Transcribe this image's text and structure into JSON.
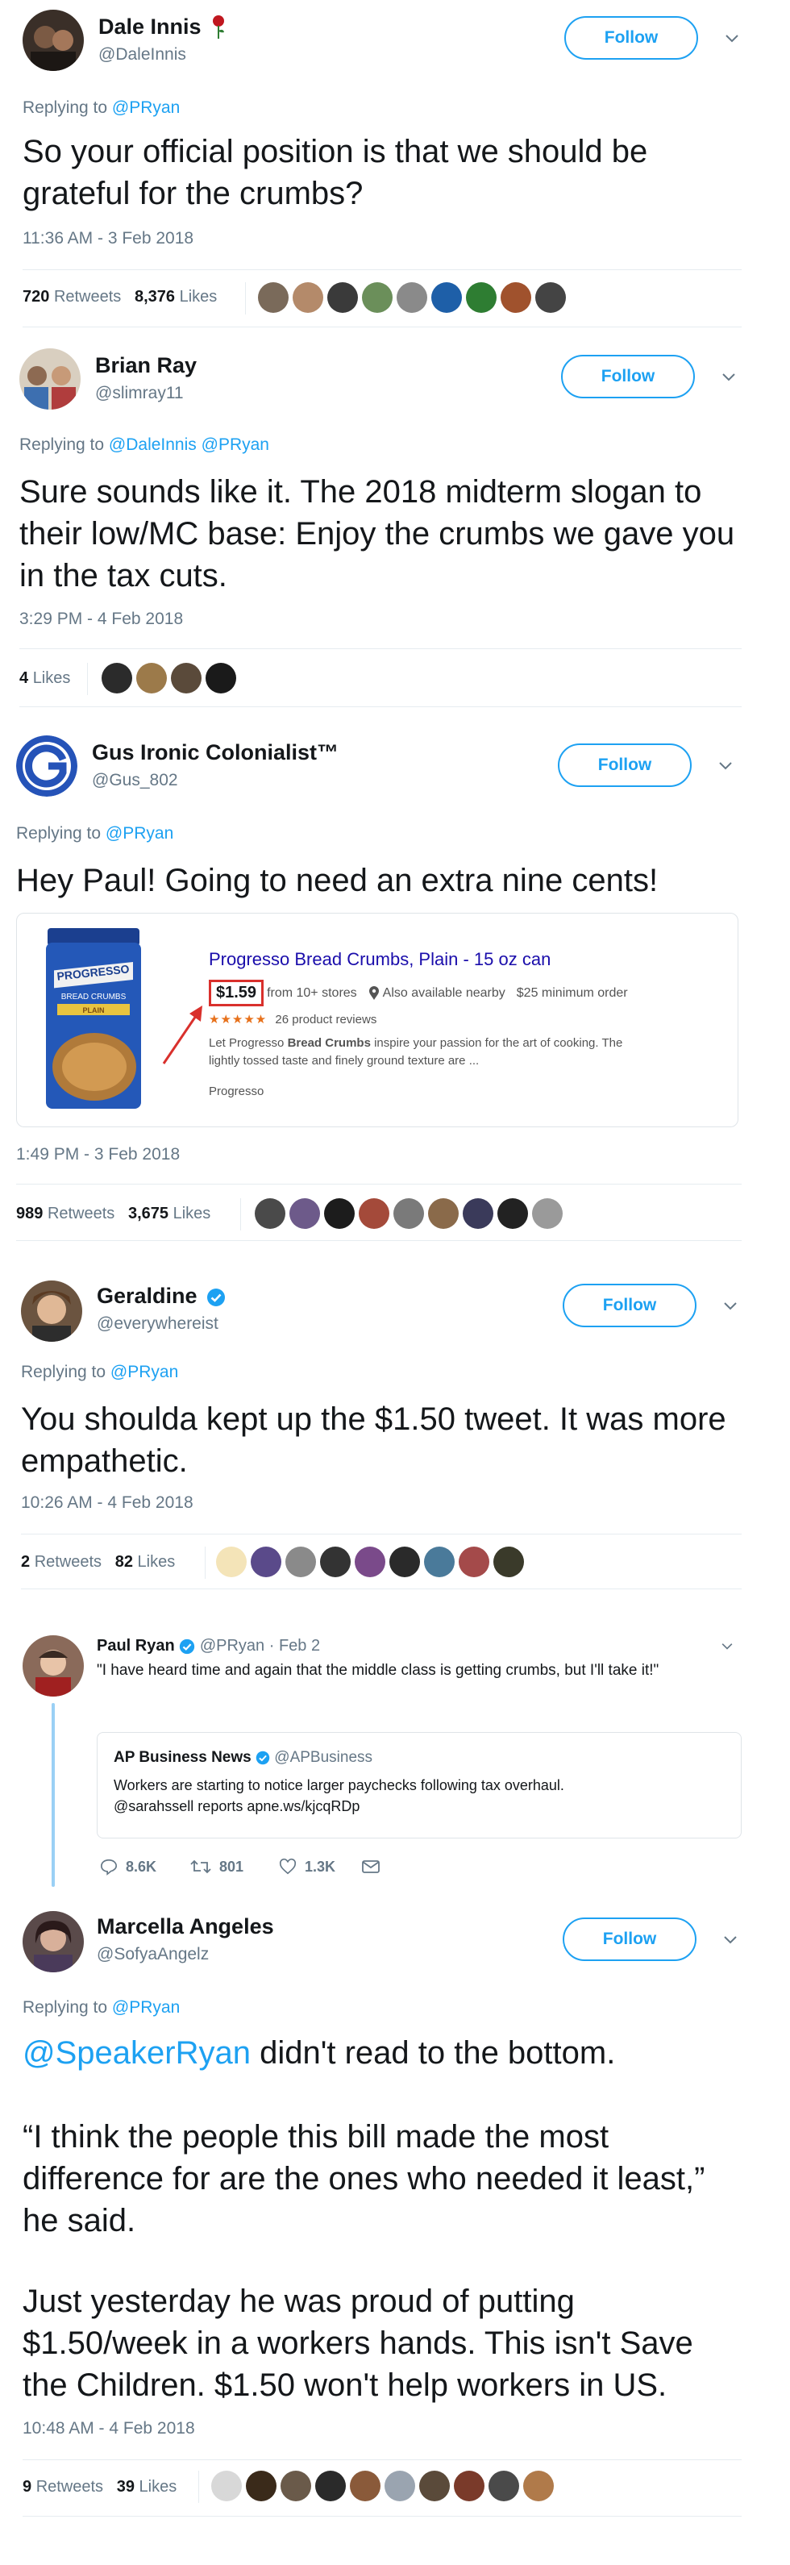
{
  "follow_label": "Follow",
  "reply_prefix": "Replying to",
  "tweets": [
    {
      "name": "Dale Innis",
      "handle": "@DaleInnis",
      "reply_to": [
        "@PRyan"
      ],
      "text": "So your official position is that we should be grateful for the crumbs?",
      "time": "11:36 AM - 3 Feb 2018",
      "retweets": "720",
      "retweets_label": "Retweets",
      "likes": "8,376",
      "likes_label": "Likes"
    },
    {
      "name": "Brian Ray",
      "handle": "@slimray11",
      "reply_to": [
        "@DaleInnis",
        "@PRyan"
      ],
      "text": "Sure sounds like it. The 2018 midterm slogan to their low/MC base: Enjoy the crumbs we gave you in the tax cuts.",
      "time": "3:29 PM - 4 Feb 2018",
      "likes": "4",
      "likes_label": "Likes"
    },
    {
      "name": "Gus Ironic Colonialist™",
      "handle": "@Gus_802",
      "reply_to": [
        "@PRyan"
      ],
      "text": "Hey Paul! Going to need an extra nine cents!",
      "time": "1:49 PM - 3 Feb 2018",
      "retweets": "989",
      "retweets_label": "Retweets",
      "likes": "3,675",
      "likes_label": "Likes",
      "product": {
        "brand_lines": [
          "PROGRESSO",
          "BREAD CRUMBS",
          "PLAIN"
        ],
        "title": "Progresso Bread Crumbs, Plain - 15 oz can",
        "price": "$1.59",
        "stores": "from 10+ stores",
        "nearby": "Also available nearby",
        "minimum": "$25 minimum order",
        "stars": "★★★★★",
        "reviews": "26 product reviews",
        "desc_pre": "Let Progresso ",
        "desc_bold": "Bread Crumbs",
        "desc_post": " inspire your passion for the art of cooking. The",
        "desc_line2": "lightly tossed taste and finely ground texture are ...",
        "seller": "Progresso"
      }
    },
    {
      "name": "Geraldine",
      "handle": "@everywhereist",
      "reply_to": [
        "@PRyan"
      ],
      "text": "You shoulda kept up the $1.50 tweet. It was more empathetic.",
      "time": "10:26 AM - 4 Feb 2018",
      "retweets": "2",
      "retweets_label": "Retweets",
      "likes": "82",
      "likes_label": "Likes"
    },
    {
      "name": "Marcella Angeles",
      "handle": "@SofyaAngelz",
      "reply_to": [
        "@PRyan"
      ],
      "text_mention": "@SpeakerRyan",
      "text_p1": " didn't read to the bottom.",
      "text_p2": "“I think the people this bill made the most difference for are the ones who needed it least,” he said.",
      "text_p3": "Just yesterday he was proud of putting $1.50/week in a workers hands. This isn't Save the Children. $1.50 won't help workers in US.",
      "time": "10:48 AM - 4 Feb 2018",
      "retweets": "9",
      "retweets_label": "Retweets",
      "likes": "39",
      "likes_label": "Likes"
    }
  ],
  "quoted": {
    "name": "Paul Ryan",
    "handle": "@PRyan",
    "date": "· Feb 2",
    "text": "\"I have heard time and again that the middle class is getting crumbs, but I'll take it!\"",
    "inner_name": "AP Business News",
    "inner_handle": "@APBusiness",
    "inner_line1": "Workers are starting to notice larger paychecks following tax overhaul.",
    "inner_line2": "@sarahssell reports apne.ws/kjcqRDp",
    "replies": "8.6K",
    "retweets": "801",
    "likes": "1.3K"
  },
  "colors": {
    "accent": "#1da1f2",
    "muted": "#657786",
    "text": "#14171a",
    "divider": "#e6ecf0",
    "rose": "#c0171f",
    "price_box": "#d9302c"
  },
  "icons": [
    "rose-icon",
    "chevron-down-icon",
    "verified-icon",
    "reply-icon",
    "retweet-icon",
    "heart-icon",
    "mail-icon",
    "pin-icon"
  ]
}
